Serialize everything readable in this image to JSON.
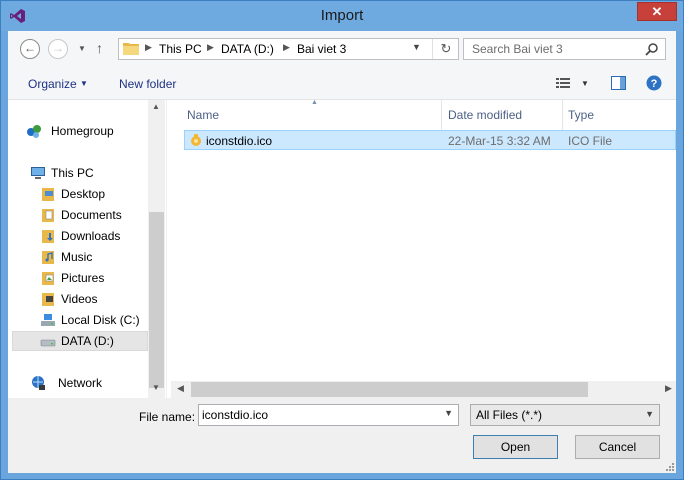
{
  "window": {
    "title": "Import"
  },
  "titlebar": {
    "close_glyph": "✕"
  },
  "address": {
    "crumbs": [
      "This PC",
      "DATA (D:)",
      "Bai viet 3"
    ]
  },
  "search": {
    "placeholder": "Search Bai viet 3"
  },
  "toolbar": {
    "organize_label": "Organize",
    "new_folder_label": "New folder"
  },
  "nav": {
    "homegroup": "Homegroup",
    "this_pc": "This PC",
    "items": [
      {
        "label": "Desktop",
        "icon": "desktop-folder-icon"
      },
      {
        "label": "Documents",
        "icon": "documents-folder-icon"
      },
      {
        "label": "Downloads",
        "icon": "downloads-folder-icon"
      },
      {
        "label": "Music",
        "icon": "music-folder-icon"
      },
      {
        "label": "Pictures",
        "icon": "pictures-folder-icon"
      },
      {
        "label": "Videos",
        "icon": "videos-folder-icon"
      },
      {
        "label": "Local Disk (C:)",
        "icon": "local-disk-icon"
      },
      {
        "label": "DATA (D:)",
        "icon": "drive-icon"
      }
    ],
    "network": "Network"
  },
  "columns": {
    "name": "Name",
    "date": "Date modified",
    "type": "Type"
  },
  "files": [
    {
      "name": "iconstdio.ico",
      "date": "22-Mar-15 3:32 AM",
      "type": "ICO File"
    }
  ],
  "bottom": {
    "file_name_label": "File name:",
    "file_name_value": "iconstdio.ico",
    "filter_value": "All Files (*.*)",
    "open_label": "Open",
    "cancel_label": "Cancel"
  },
  "colors": {
    "titlebar": "#6ea9df",
    "close": "#c7403a",
    "selection": "#cce8ff",
    "link": "#1e3287"
  }
}
